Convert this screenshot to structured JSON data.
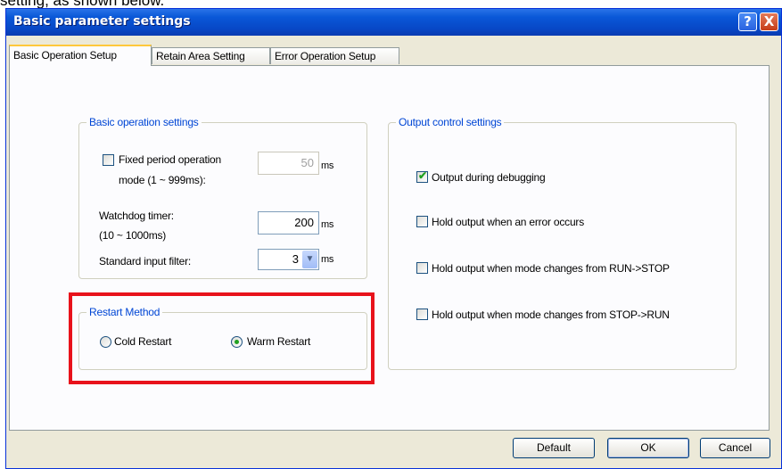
{
  "caption": "setting, as shown below.",
  "window": {
    "title": "Basic parameter settings",
    "help_label": "?",
    "close_label": "X"
  },
  "tabs": [
    {
      "label": "Basic Operation Setup",
      "active": true
    },
    {
      "label": "Retain Area Setting",
      "active": false
    },
    {
      "label": "Error Operation Setup",
      "active": false
    }
  ],
  "basic_operation": {
    "title": "Basic operation settings",
    "fixed_period": {
      "label_line1": "Fixed period operation",
      "label_line2": "mode (1 ~ 999ms):",
      "checked": false,
      "value": "50",
      "unit": "ms"
    },
    "watchdog": {
      "label_line1": "Watchdog timer:",
      "label_line2": "(10 ~ 1000ms)",
      "value": "200",
      "unit": "ms"
    },
    "input_filter": {
      "label": "Standard input filter:",
      "value": "3",
      "unit": "ms"
    }
  },
  "restart": {
    "title": "Restart Method",
    "options": [
      {
        "label": "Cold Restart",
        "selected": false
      },
      {
        "label": "Warm Restart",
        "selected": true
      }
    ]
  },
  "output_control": {
    "title": "Output control settings",
    "options": [
      {
        "label": "Output during debugging",
        "checked": true
      },
      {
        "label": "Hold output when an error occurs",
        "checked": false
      },
      {
        "label": "Hold output when mode changes from RUN->STOP",
        "checked": false
      },
      {
        "label": "Hold output when mode changes from STOP->RUN",
        "checked": false
      }
    ]
  },
  "buttons": {
    "default": "Default",
    "ok": "OK",
    "cancel": "Cancel"
  },
  "colors": {
    "titlebar": "#0a58d8",
    "group_title": "#0046d5",
    "highlight": "#e8121b",
    "checkmark": "#21a121"
  },
  "icons": {
    "help": "help-icon",
    "close": "close-icon",
    "dropdown": "chevron-down-icon"
  }
}
